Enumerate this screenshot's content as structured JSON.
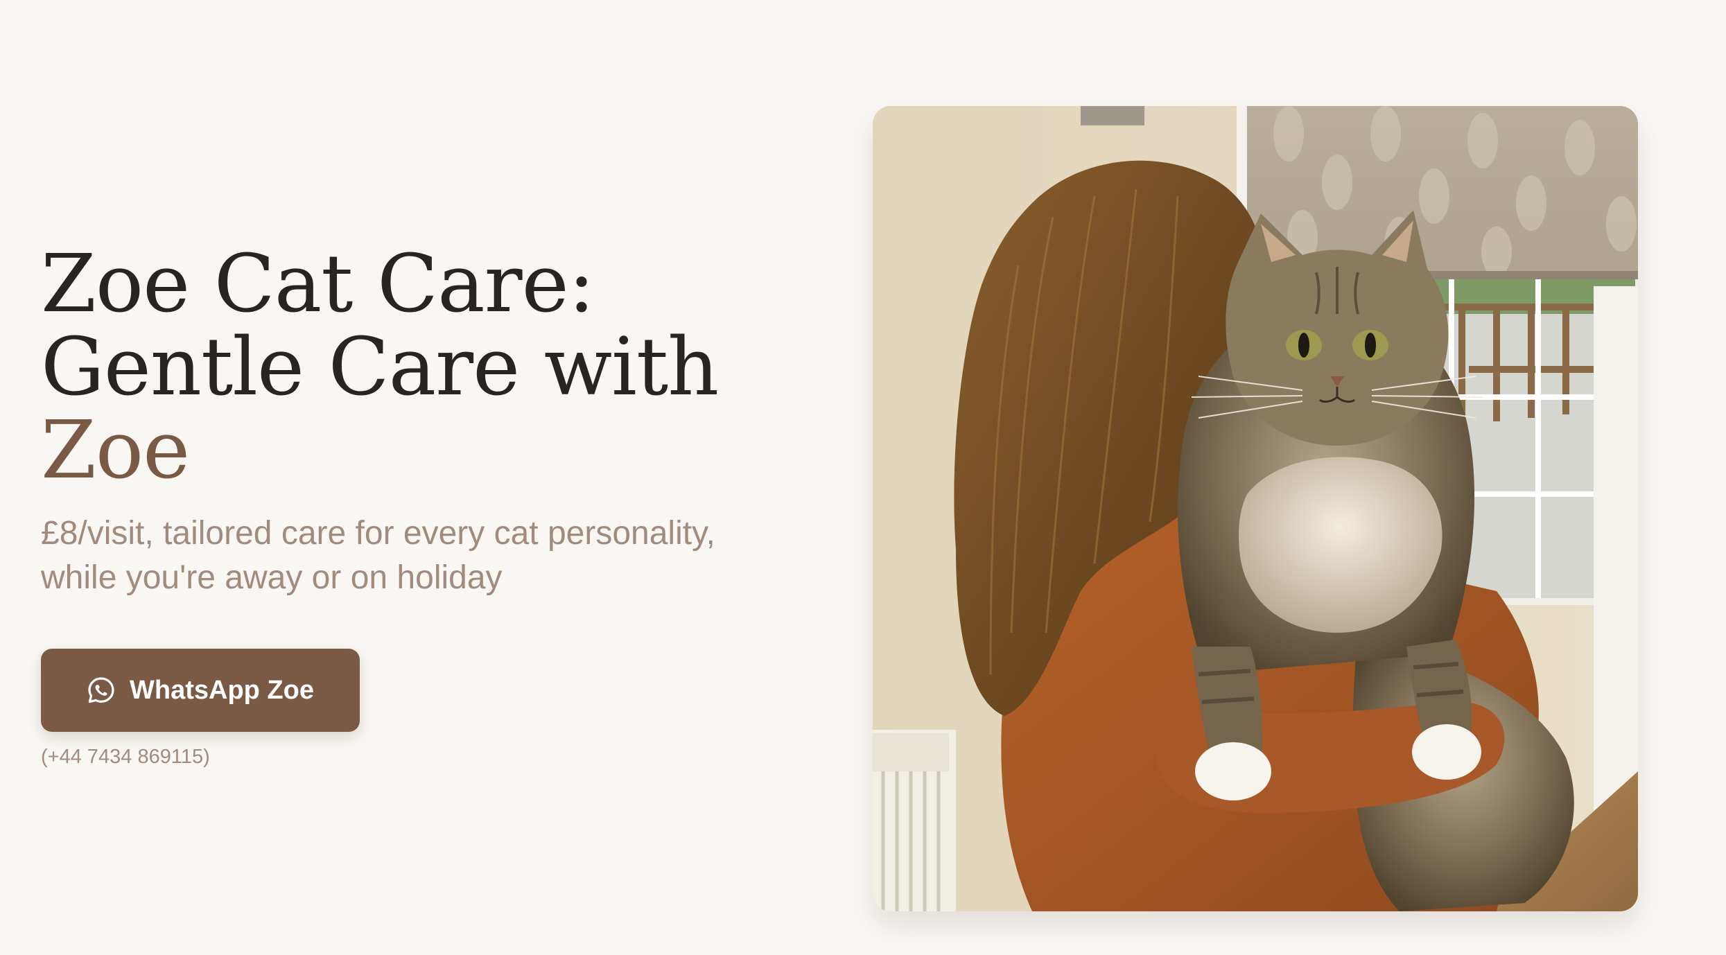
{
  "hero": {
    "title_line1": "Zoe Cat Care:",
    "title_line2": "Gentle Care with",
    "title_accent": "Zoe",
    "subtitle_line1": "£8/visit, tailored care for every cat personality,",
    "subtitle_line2": "while you're away or on holiday",
    "cta_label": "WhatsApp Zoe",
    "cta_icon": "whatsapp-icon",
    "phone": "(+44 7434 869115)"
  },
  "colors": {
    "background": "#f9f7f4",
    "title": "#2a2421",
    "accent": "#7a5a45",
    "muted": "#a08b7d",
    "button_text": "#ffffff"
  }
}
